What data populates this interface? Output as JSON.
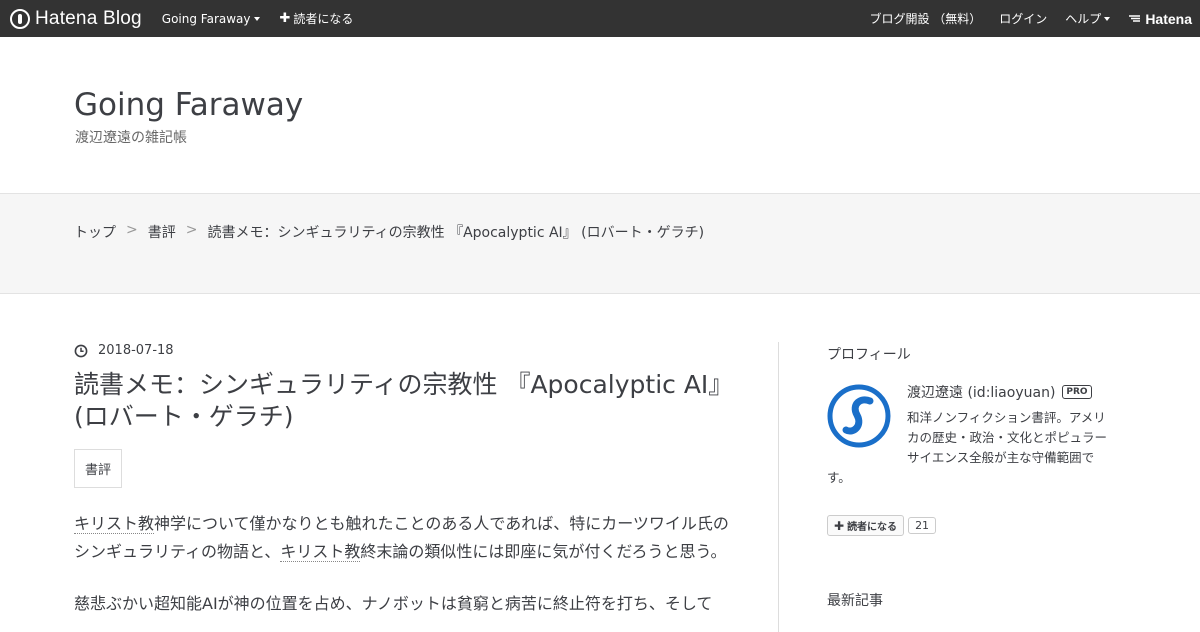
{
  "topbar": {
    "brand": "Hatena Blog",
    "blog_menu": "Going Faraway",
    "subscribe": "読者になる",
    "open_blog": "ブログ開設 （無料）",
    "login": "ログイン",
    "help": "ヘルプ",
    "hatena": "Hatena"
  },
  "header": {
    "title": "Going Faraway",
    "description": "渡辺遼遠の雑記帳"
  },
  "breadcrumb": {
    "items": [
      "トップ",
      "書評",
      "読書メモ：シンギュラリティの宗教性 『Apocalyptic AI』 (ロバート・ゲラチ)"
    ],
    "separator": ">"
  },
  "article": {
    "date": "2018-07-18",
    "title": "読書メモ：シンギュラリティの宗教性 『Apocalyptic AI』 (ロバート・ゲラチ)",
    "category": "書評",
    "p1_kw1": "キリスト教",
    "p1_a": "神学について僅かなりとも触れたことのある人であれば、特にカーツワイル氏のシンギュラリティの物語と、",
    "p1_kw2": "キリスト教",
    "p1_b": "終末論の類似性には即座に気が付くだろうと思う。",
    "p2": "慈悲ぶかい超知能AIが神の位置を占め、ナノボットは貧窮と病苦に終止符を打ち、そして"
  },
  "sidebar": {
    "profile_heading": "プロフィール",
    "profile_name": "渡辺遼遠 (id:liaoyuan)",
    "pro_badge": "PRO",
    "bio_lines": [
      "和洋ノンフィクション書評。アメリ",
      "カの歴史・政治・文化とポピュラー",
      "サイエンス全般が主な守備範囲で"
    ],
    "bio_last": "す。",
    "subscribe_label": "読者になる",
    "subscriber_count": "21",
    "recent_heading": "最新記事"
  },
  "colors": {
    "topbar_bg": "#333333",
    "band_bg": "#f6f6f6",
    "text": "#3d3f44",
    "avatar_blue": "#1a6fc9"
  }
}
